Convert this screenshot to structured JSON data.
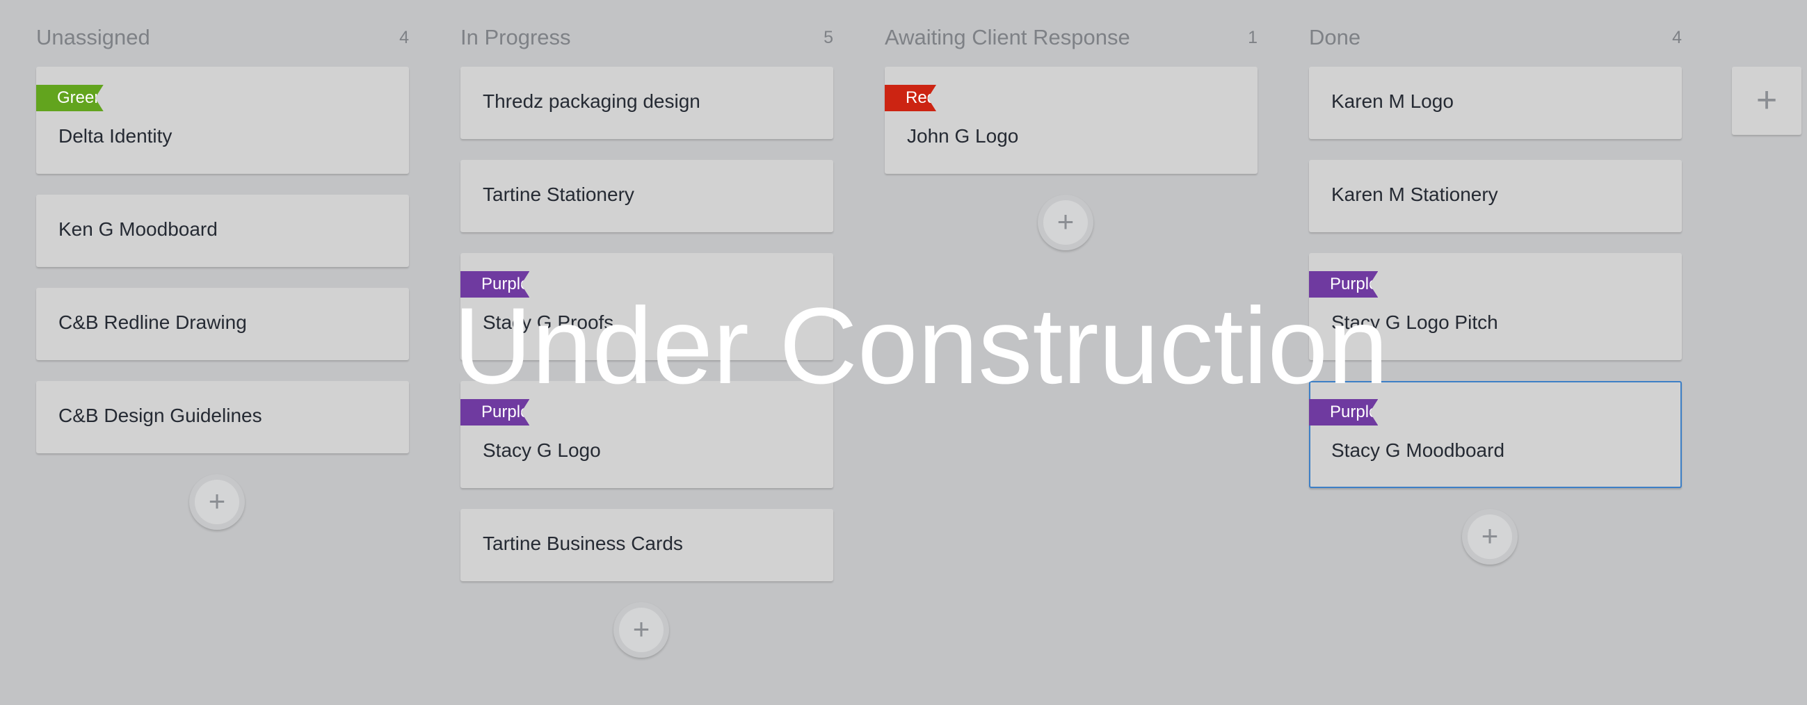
{
  "board": {
    "columns": [
      {
        "title": "Unassigned",
        "count": "4",
        "cards": [
          {
            "title": "Delta Identity",
            "label": "Green"
          },
          {
            "title": "Ken G Moodboard"
          },
          {
            "title": "C&B Redline Drawing"
          },
          {
            "title": "C&B Design Guidelines"
          }
        ]
      },
      {
        "title": "In Progress",
        "count": "5",
        "cards": [
          {
            "title": "Thredz packaging design"
          },
          {
            "title": "Tartine Stationery"
          },
          {
            "title": "Stacy G Proofs",
            "label": "Purple"
          },
          {
            "title": "Stacy G Logo",
            "label": "Purple"
          },
          {
            "title": "Tartine Business Cards"
          }
        ]
      },
      {
        "title": "Awaiting Client Response",
        "count": "1",
        "cards": [
          {
            "title": "John G Logo",
            "label": "Red"
          }
        ]
      },
      {
        "title": "Done",
        "count": "4",
        "cards": [
          {
            "title": "Karen M Logo"
          },
          {
            "title": "Karen M Stationery"
          },
          {
            "title": "Stacy G Logo Pitch",
            "label": "Purple"
          },
          {
            "title": "Stacy G Moodboard",
            "label": "Purple",
            "selected": true
          }
        ]
      }
    ],
    "add_card_icon": "+",
    "add_column_icon": "+"
  },
  "overlay": {
    "text": "Under Construction"
  },
  "colors": {
    "green": "#62a41e",
    "red": "#cc2412",
    "purple": "#6f3aa0",
    "selected_border": "#3d7fc6"
  },
  "icons": {
    "add_card": "plus-icon",
    "add_column": "plus-icon"
  }
}
